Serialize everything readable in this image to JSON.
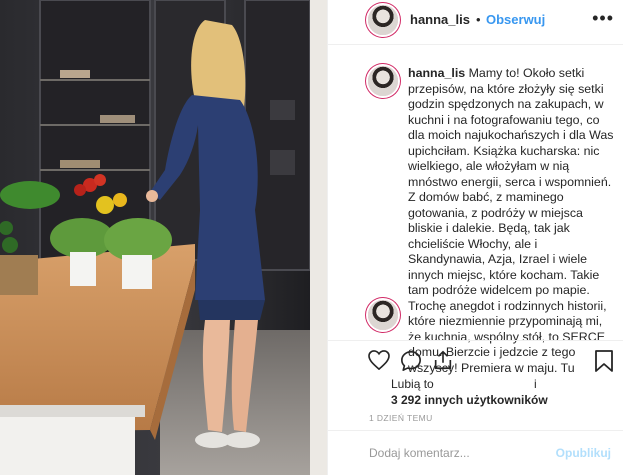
{
  "photo": {
    "alt_icon": "kitchen-photo"
  },
  "header": {
    "username": "hanna_lis",
    "dot": "•",
    "follow_label": "Obserwuj",
    "more": "•••"
  },
  "caption": {
    "username": "hanna_lis",
    "text": "Mamy to! Około setki przepisów, na które złożyły się setki godzin spędzonych na zakupach, w kuchni i na fotografowaniu tego, co dla moich najukochańszych i dla Was upichciłam. Książka kucharska: nic wielkiego, ale włożyłam w nią mnóstwo energii, serca i wspomnień. Z domów babć, z maminego gotowania, z podróży w miejsca bliskie i dalekie. Będą, tak jak chcieliście Włochy, ale i Skandynawia, Azja, Izrael i wiele innych miejsc, które kocham. Takie tam podróże widelcem po mapie. Trochę anegdot i rodzinnych historii, które niezmiennie przypominają mi, że kuchnia, wspólny stół, to SERCE domu. Bierzcie i jedzcie z tego wszyscy! Premiera w maju. Tu"
  },
  "actions": {
    "like_icon": "heart-icon",
    "comment_icon": "comment-icon",
    "share_icon": "share-icon",
    "save_icon": "bookmark-icon"
  },
  "likes": {
    "line1": "Lubią to",
    "line2": "3 292 innych użytkowników",
    "marker": "i"
  },
  "timestamp": "1 DZIEŃ TEMU",
  "comment_box": {
    "placeholder": "Dodaj komentarz...",
    "post_label": "Opublikuj"
  }
}
